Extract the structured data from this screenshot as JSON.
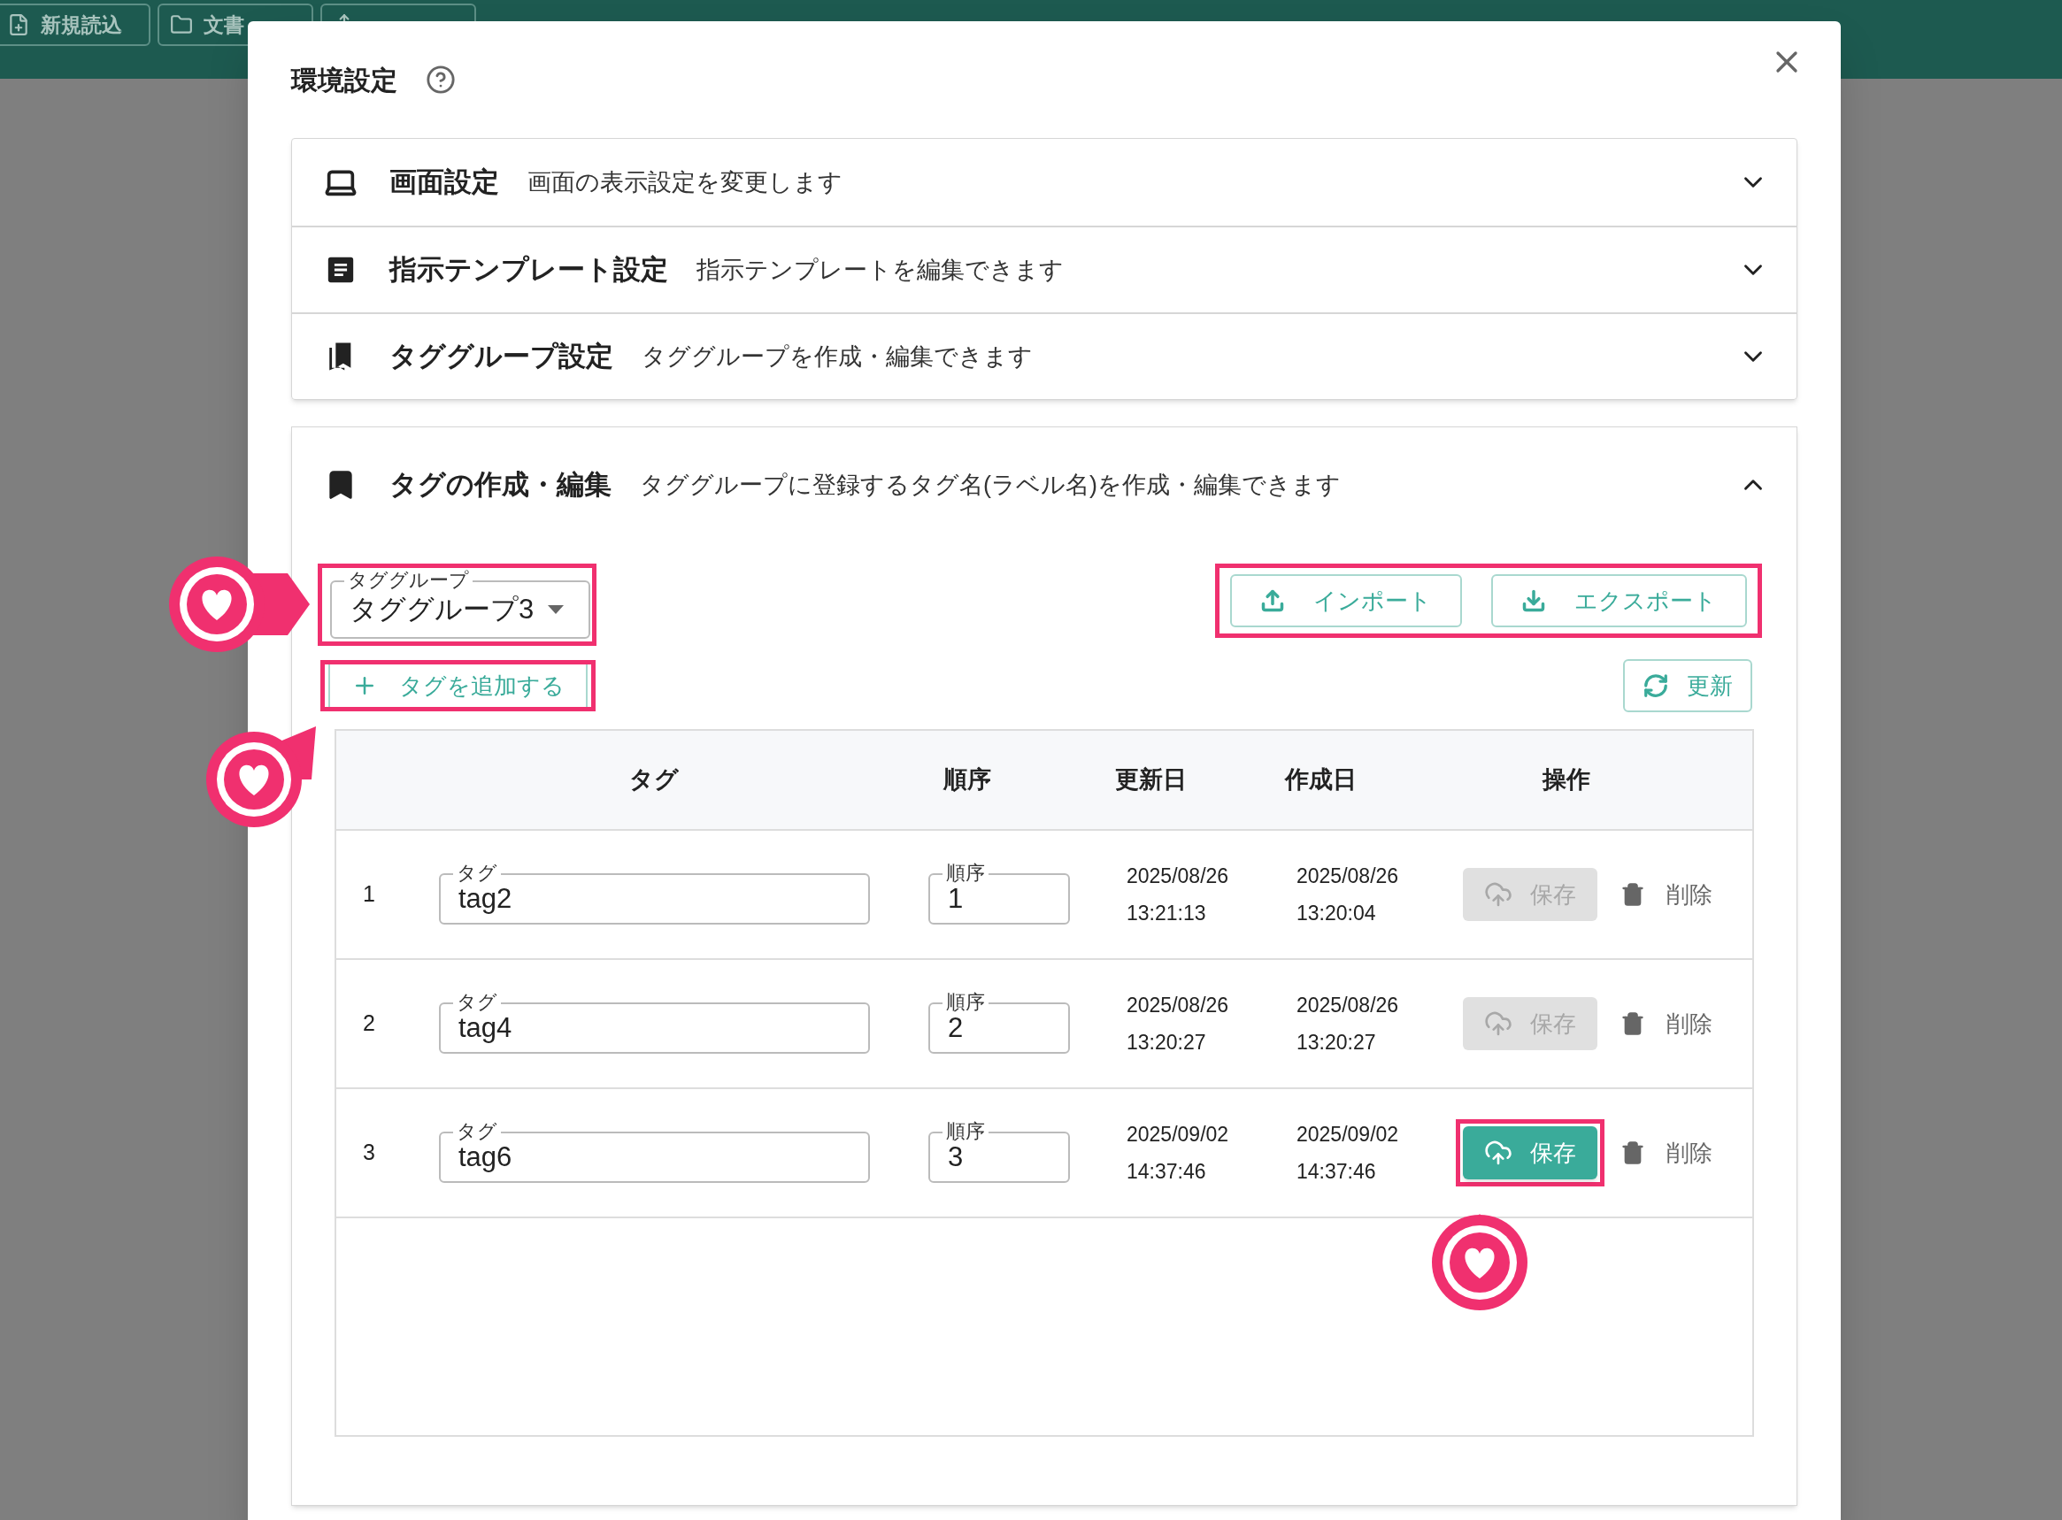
{
  "top_bar": {
    "buttons": [
      {
        "label": "新規読込",
        "kind": "new"
      },
      {
        "label": "文書",
        "kind": "folder"
      },
      {
        "kind": "share"
      }
    ]
  },
  "dialog": {
    "title": "環境設定",
    "sections": [
      {
        "kind": "display",
        "title": "画面設定",
        "description": "画面の表示設定を変更します",
        "expanded": false
      },
      {
        "kind": "template",
        "title": "指示テンプレート設定",
        "description": "指示テンプレートを編集できます",
        "expanded": false
      },
      {
        "kind": "group",
        "title": "タググループ設定",
        "description": "タググループを作成・編集できます",
        "expanded": false
      }
    ],
    "tag_section": {
      "title": "タグの作成・編集",
      "description": "タググループに登録するタグ名(ラベル名)を作成・編集できます",
      "expanded": true,
      "group_select": {
        "label": "タググループ",
        "value": "タググループ3"
      },
      "import_button": "インポート",
      "export_button": "エクスポート",
      "add_button": "タグを追加する",
      "refresh_button": "更新",
      "table": {
        "columns": [
          "タグ",
          "順序",
          "更新日",
          "作成日",
          "操作"
        ],
        "rows": [
          {
            "index": "1",
            "tag_label": "タグ",
            "tag": "tag2",
            "order_label": "順序",
            "order": "1",
            "updated": [
              "2025/08/26",
              "13:21:13"
            ],
            "created": [
              "2025/08/26",
              "13:20:04"
            ],
            "save": "保存",
            "save_disabled": true,
            "highlighted": false,
            "delete": "削除"
          },
          {
            "index": "2",
            "tag_label": "タグ",
            "tag": "tag4",
            "order_label": "順序",
            "order": "2",
            "updated": [
              "2025/08/26",
              "13:20:27"
            ],
            "created": [
              "2025/08/26",
              "13:20:27"
            ],
            "save": "保存",
            "save_disabled": true,
            "highlighted": false,
            "delete": "削除"
          },
          {
            "index": "3",
            "tag_label": "タグ",
            "tag": "tag6",
            "order_label": "順序",
            "order": "3",
            "updated": [
              "2025/09/02",
              "14:37:46"
            ],
            "created": [
              "2025/09/02",
              "14:37:46"
            ],
            "save": "保存",
            "save_disabled": false,
            "highlighted": true,
            "delete": "削除"
          }
        ]
      }
    }
  }
}
